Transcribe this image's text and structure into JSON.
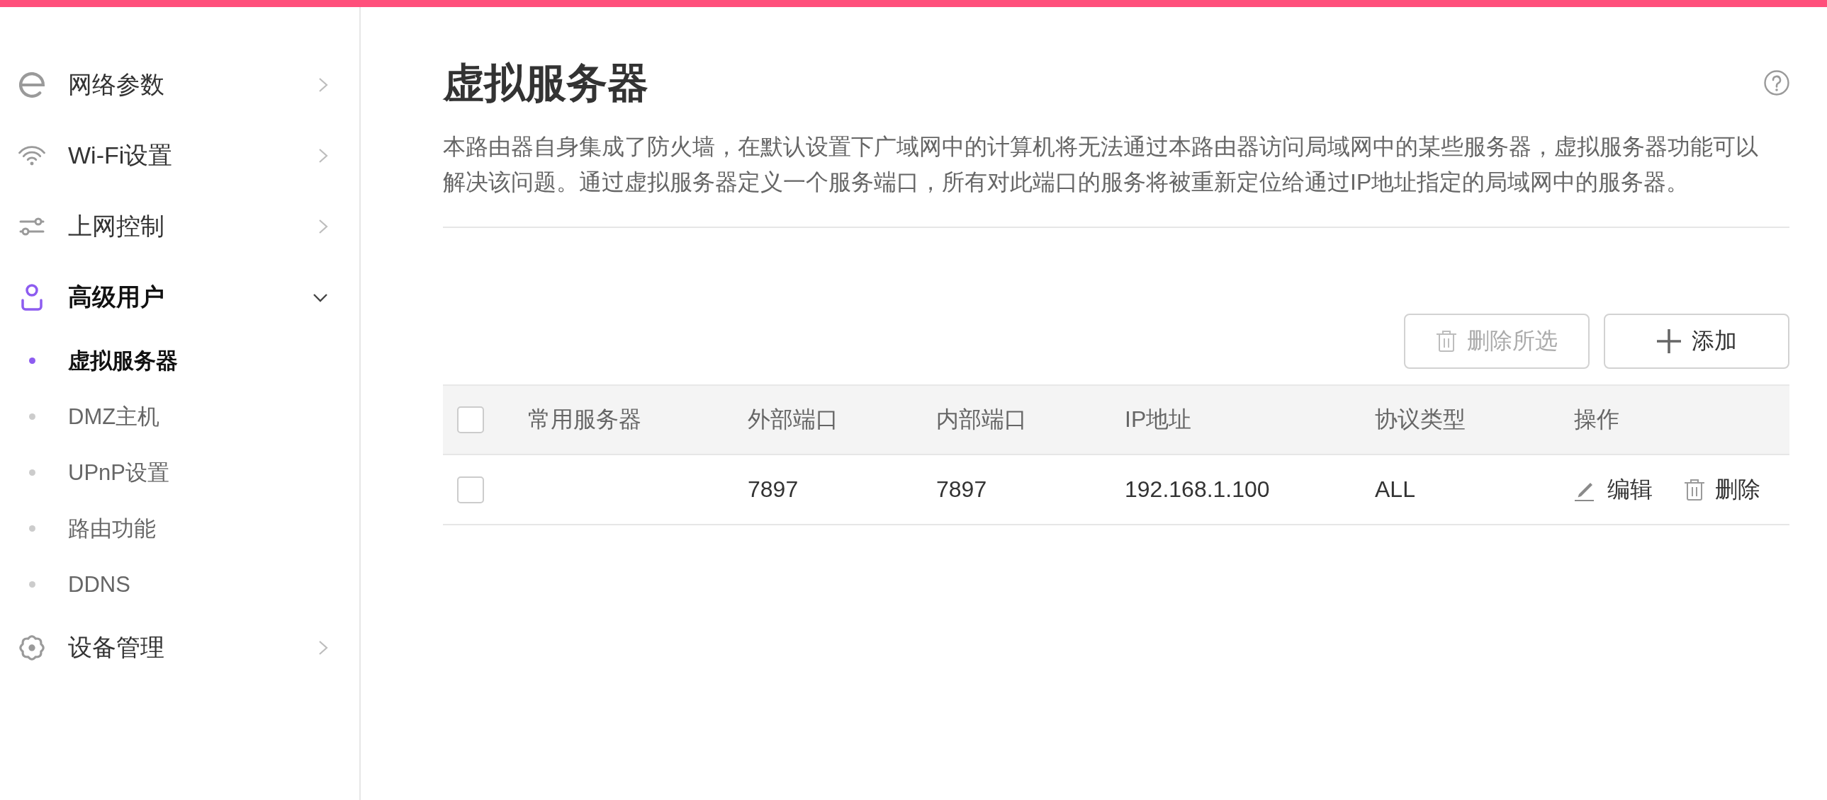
{
  "sidebar": {
    "items": [
      {
        "label": "网络参数",
        "selected": false,
        "expanded": false
      },
      {
        "label": "Wi-Fi设置",
        "selected": false,
        "expanded": false
      },
      {
        "label": "上网控制",
        "selected": false,
        "expanded": false
      },
      {
        "label": "高级用户",
        "selected": true,
        "expanded": true,
        "children": [
          {
            "label": "虚拟服务器",
            "selected": true
          },
          {
            "label": "DMZ主机",
            "selected": false
          },
          {
            "label": "UPnP设置",
            "selected": false
          },
          {
            "label": "路由功能",
            "selected": false
          },
          {
            "label": "DDNS",
            "selected": false
          }
        ]
      },
      {
        "label": "设备管理",
        "selected": false,
        "expanded": false
      }
    ]
  },
  "page": {
    "title": "虚拟服务器",
    "description": "本路由器自身集成了防火墙，在默认设置下广域网中的计算机将无法通过本路由器访问局域网中的某些服务器，虚拟服务器功能可以解决该问题。通过虚拟服务器定义一个服务端口，所有对此端口的服务将被重新定位给通过IP地址指定的局域网中的服务器。"
  },
  "toolbar": {
    "buttons": [
      {
        "kind": "delete",
        "label": "删除所选",
        "disabled": true
      },
      {
        "kind": "add",
        "label": "添加",
        "disabled": false
      }
    ]
  },
  "table": {
    "select_all": {
      "checked": false
    },
    "columns": [
      "常用服务器",
      "外部端口",
      "内部端口",
      "IP地址",
      "协议类型",
      "操作"
    ],
    "rows": [
      {
        "checked": false,
        "external_port": "7897",
        "internal_port": "7897",
        "ip_address": "192.168.1.100",
        "protocol": "ALL",
        "actions": [
          {
            "kind": "edit",
            "label": "编辑"
          },
          {
            "kind": "delete",
            "label": "删除"
          }
        ]
      }
    ]
  }
}
